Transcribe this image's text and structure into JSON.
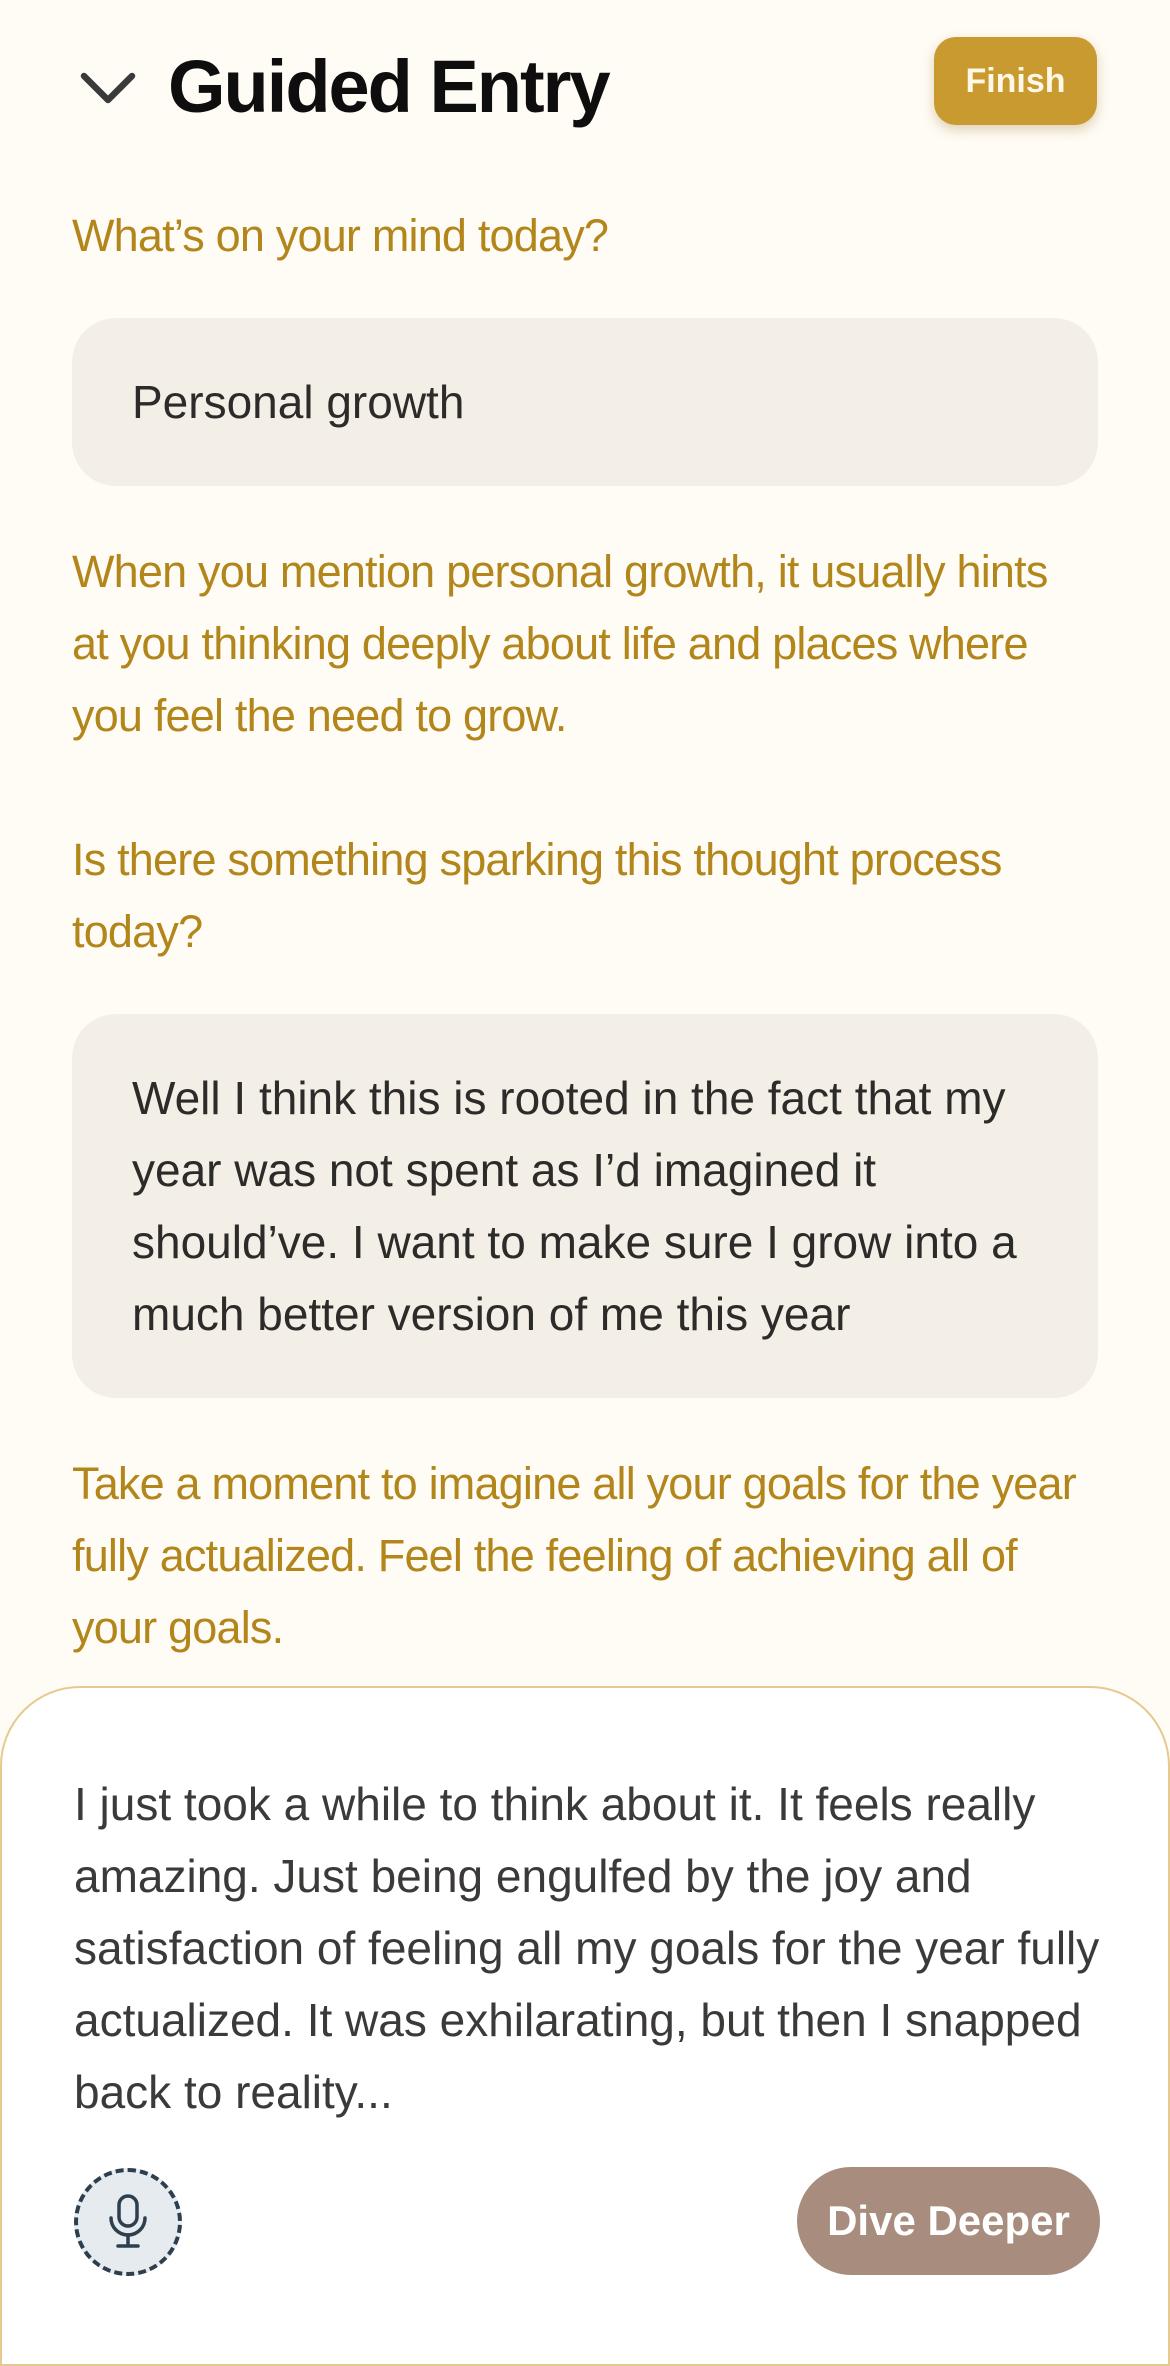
{
  "header": {
    "title": "Guided Entry",
    "finish_label": "Finish"
  },
  "entries": [
    {
      "prompt": "What’s on your mind today?",
      "answer": "Personal growth"
    },
    {
      "prompt_1": "When you mention personal growth, it usually hints at you thinking deeply about life and places where you feel the need to grow.",
      "prompt_2": "Is there something sparking this thought process today?",
      "answer": "Well I think this is rooted in the fact that my year was not spent as I’d imagined it should’ve. I want to make sure I grow into a much better version of me this year"
    },
    {
      "prompt": "Take a moment to imagine all your goals for the year fully actualized. Feel the feeling of achieving all of your goals."
    }
  ],
  "composer": {
    "text": "I just took a while to think about it. It feels really amazing. Just being engulfed by the joy and satisfaction of feeling all my goals for the year fully actualized. It was exhilarating, but then I snapped back to reality...",
    "mic_icon": "microphone-icon",
    "dive_label": "Dive Deeper"
  },
  "colors": {
    "background": "#fffcf5",
    "prompt_text": "#b3861c",
    "finish_button": "#c99a30",
    "answer_bubble": "#f3efe7",
    "dive_button": "#a88d7e",
    "composer_border": "#e6c98e"
  }
}
